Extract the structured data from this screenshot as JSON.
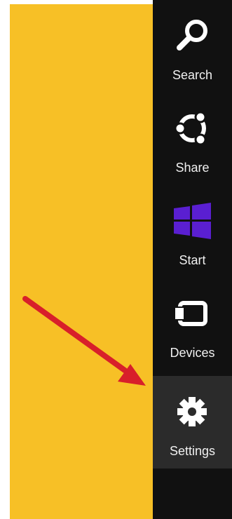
{
  "desktop": {
    "background_color": "#f7c026"
  },
  "charms_bar": {
    "background_color": "#111111",
    "selected_color": "#2b2b2b",
    "items": [
      {
        "label": "Search",
        "icon": "search-icon"
      },
      {
        "label": "Share",
        "icon": "share-icon"
      },
      {
        "label": "Start",
        "icon": "windows-logo-icon",
        "icon_color": "#5a1fd1"
      },
      {
        "label": "Devices",
        "icon": "devices-icon"
      },
      {
        "label": "Settings",
        "icon": "gear-icon",
        "selected": true
      }
    ]
  },
  "annotation": {
    "arrow_color": "#d81f2a",
    "points_to": "Settings"
  }
}
